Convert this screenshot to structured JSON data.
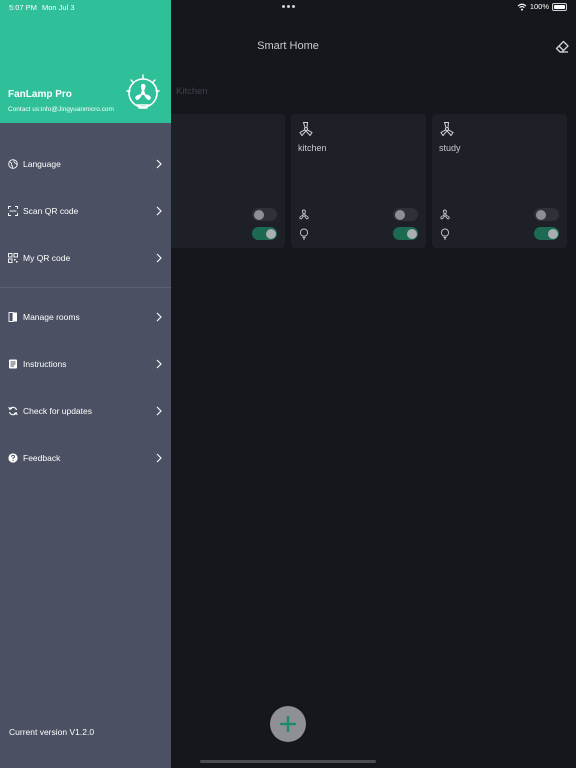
{
  "status_bar": {
    "time": "5:07 PM",
    "date": "Mon Jul 3",
    "battery": "100%"
  },
  "header": {
    "title": "Smart Home"
  },
  "rooms_tabs": {
    "visible_tab": "Kitchen"
  },
  "devices": [
    {
      "name": "",
      "fan_on": false,
      "light_on": true
    },
    {
      "name": "kitchen",
      "fan_on": false,
      "light_on": true
    },
    {
      "name": "study",
      "fan_on": false,
      "light_on": true
    }
  ],
  "drawer": {
    "app_name": "FanLamp Pro",
    "contact": "Contact us:info@Jingyuanmicro.com",
    "menu": [
      {
        "label": "Language",
        "icon": "globe-icon"
      },
      {
        "label": "Scan QR code",
        "icon": "scan-icon"
      },
      {
        "label": "My QR code",
        "icon": "qr-code-icon"
      },
      {
        "label": "Manage rooms",
        "icon": "door-icon"
      },
      {
        "label": "Instructions",
        "icon": "document-icon"
      },
      {
        "label": "Check for updates",
        "icon": "refresh-icon"
      },
      {
        "label": "Feedback",
        "icon": "help-icon"
      }
    ],
    "version": "Current version V1.2.0"
  },
  "colors": {
    "accent": "#2fbf99",
    "drawer_bg": "#4b5163",
    "background": "#15171c",
    "card_bg": "#1d2027",
    "toggle_on": "#1c6a52"
  }
}
